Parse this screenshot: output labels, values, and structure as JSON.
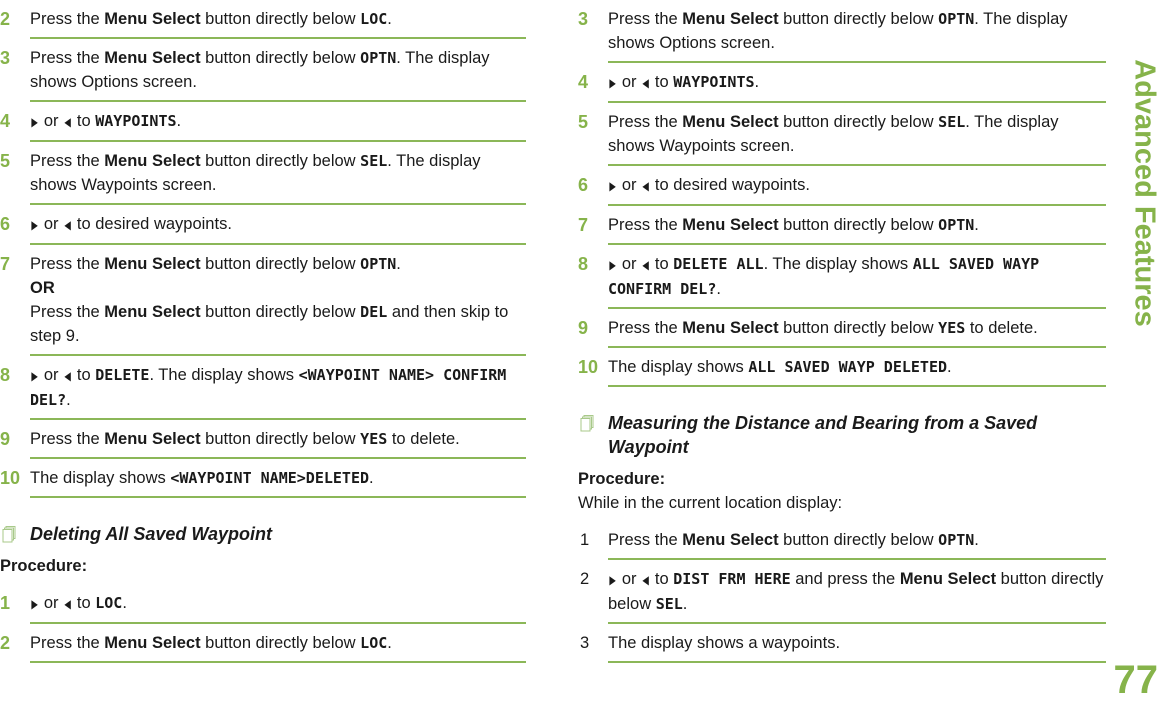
{
  "side_tab": "Advanced Features",
  "page_number": "77",
  "colors": {
    "accent": "#86b34a",
    "rule": "#8bb758",
    "text": "#1a1a1a"
  },
  "icons": {
    "right_arrow": "▶",
    "left_arrow": "◀",
    "section": "stacked-pages-icon"
  },
  "left": {
    "steps_a": [
      {
        "num": "2",
        "parts": [
          {
            "t": "Press the "
          },
          {
            "b": "Menu Select"
          },
          {
            "t": " button directly below "
          },
          {
            "d": "LOC"
          },
          {
            "t": "."
          }
        ]
      },
      {
        "num": "3",
        "parts": [
          {
            "t": "Press the "
          },
          {
            "b": "Menu Select"
          },
          {
            "t": " button directly below "
          },
          {
            "d": "OPTN"
          },
          {
            "t": ". The display shows Options screen."
          }
        ]
      },
      {
        "num": "4",
        "parts": [
          {
            "a": "right"
          },
          {
            "t": " or "
          },
          {
            "a": "left"
          },
          {
            "t": " to "
          },
          {
            "d": "WAYPOINTS"
          },
          {
            "t": "."
          }
        ]
      },
      {
        "num": "5",
        "parts": [
          {
            "t": "Press the "
          },
          {
            "b": "Menu Select"
          },
          {
            "t": " button directly below "
          },
          {
            "d": "SEL"
          },
          {
            "t": ". The display shows Waypoints screen."
          }
        ]
      },
      {
        "num": "6",
        "parts": [
          {
            "a": "right"
          },
          {
            "t": " or "
          },
          {
            "a": "left"
          },
          {
            "t": " to desired waypoints."
          }
        ]
      },
      {
        "num": "7",
        "parts": [
          {
            "t": "Press the "
          },
          {
            "b": "Menu Select"
          },
          {
            "t": " button directly below "
          },
          {
            "d": "OPTN"
          },
          {
            "t": "."
          },
          {
            "br": 1
          },
          {
            "b": "OR"
          },
          {
            "br": 1
          },
          {
            "t": "Press the "
          },
          {
            "b": "Menu Select"
          },
          {
            "t": " button directly below "
          },
          {
            "d": "DEL"
          },
          {
            "t": " and then skip to step 9."
          }
        ]
      },
      {
        "num": "8",
        "parts": [
          {
            "a": "right"
          },
          {
            "t": " or "
          },
          {
            "a": "left"
          },
          {
            "t": " to "
          },
          {
            "d": "DELETE"
          },
          {
            "t": ". The display shows "
          },
          {
            "d": "<WAYPOINT NAME> CONFIRM DEL?"
          },
          {
            "t": "."
          }
        ]
      },
      {
        "num": "9",
        "parts": [
          {
            "t": "Press the "
          },
          {
            "b": "Menu Select"
          },
          {
            "t": " button directly below "
          },
          {
            "d": "YES"
          },
          {
            "t": " to delete."
          }
        ]
      },
      {
        "num": "10",
        "parts": [
          {
            "t": "The display shows "
          },
          {
            "d": "<WAYPOINT NAME>DELETED"
          },
          {
            "t": "."
          }
        ]
      }
    ],
    "section_title": "Deleting All Saved Waypoint",
    "procedure_label": "Procedure:",
    "steps_b": [
      {
        "num": "1",
        "parts": [
          {
            "a": "right"
          },
          {
            "t": " or "
          },
          {
            "a": "left"
          },
          {
            "t": " to "
          },
          {
            "d": "LOC"
          },
          {
            "t": "."
          }
        ]
      },
      {
        "num": "2",
        "parts": [
          {
            "t": "Press the "
          },
          {
            "b": "Menu Select"
          },
          {
            "t": " button directly below "
          },
          {
            "d": "LOC"
          },
          {
            "t": "."
          }
        ]
      }
    ]
  },
  "right": {
    "steps_a": [
      {
        "num": "3",
        "parts": [
          {
            "t": "Press the "
          },
          {
            "b": "Menu Select"
          },
          {
            "t": " button directly below "
          },
          {
            "d": "OPTN"
          },
          {
            "t": ". The display shows Options screen."
          }
        ]
      },
      {
        "num": "4",
        "parts": [
          {
            "a": "right"
          },
          {
            "t": " or "
          },
          {
            "a": "left"
          },
          {
            "t": " to "
          },
          {
            "d": "WAYPOINTS"
          },
          {
            "t": "."
          }
        ]
      },
      {
        "num": "5",
        "parts": [
          {
            "t": "Press the "
          },
          {
            "b": "Menu Select"
          },
          {
            "t": " button directly below "
          },
          {
            "d": "SEL"
          },
          {
            "t": ". The display shows Waypoints screen."
          }
        ]
      },
      {
        "num": "6",
        "parts": [
          {
            "a": "right"
          },
          {
            "t": " or "
          },
          {
            "a": "left"
          },
          {
            "t": " to desired waypoints."
          }
        ]
      },
      {
        "num": "7",
        "parts": [
          {
            "t": "Press the "
          },
          {
            "b": "Menu Select"
          },
          {
            "t": " button directly below "
          },
          {
            "d": "OPTN"
          },
          {
            "t": "."
          }
        ]
      },
      {
        "num": "8",
        "parts": [
          {
            "a": "right"
          },
          {
            "t": " or "
          },
          {
            "a": "left"
          },
          {
            "t": " to "
          },
          {
            "d": "DELETE ALL"
          },
          {
            "t": ". The display shows "
          },
          {
            "d": "ALL SAVED WAYP CONFIRM DEL?"
          },
          {
            "t": "."
          }
        ]
      },
      {
        "num": "9",
        "parts": [
          {
            "t": "Press the "
          },
          {
            "b": "Menu Select"
          },
          {
            "t": " button directly below "
          },
          {
            "d": "YES"
          },
          {
            "t": " to delete."
          }
        ]
      },
      {
        "num": "10",
        "parts": [
          {
            "t": "The display shows "
          },
          {
            "d": "ALL SAVED WAYP DELETED"
          },
          {
            "t": "."
          }
        ]
      }
    ],
    "section_title": "Measuring the Distance and Bearing from a Saved Waypoint",
    "procedure_label": "Procedure:",
    "procedure_intro": "While in the current location display:",
    "steps_b": [
      {
        "num": "1",
        "parts": [
          {
            "t": "Press the "
          },
          {
            "b": "Menu Select"
          },
          {
            "t": " button directly below "
          },
          {
            "d": "OPTN"
          },
          {
            "t": "."
          }
        ]
      },
      {
        "num": "2",
        "parts": [
          {
            "a": "right"
          },
          {
            "t": " or "
          },
          {
            "a": "left"
          },
          {
            "t": " to "
          },
          {
            "d": "DIST FRM HERE"
          },
          {
            "t": " and press the "
          },
          {
            "b": "Menu Select"
          },
          {
            "t": " button directly below "
          },
          {
            "d": "SEL"
          },
          {
            "t": "."
          }
        ]
      },
      {
        "num": "3",
        "parts": [
          {
            "t": "The display shows a waypoints."
          }
        ]
      }
    ]
  }
}
